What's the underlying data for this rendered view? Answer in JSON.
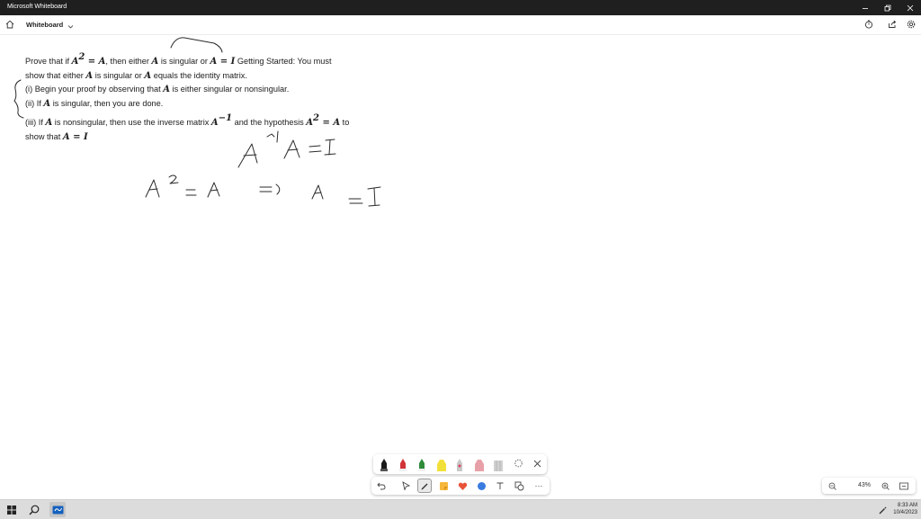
{
  "window": {
    "title": "Microsoft Whiteboard",
    "controls": [
      "minimize-icon",
      "restore-icon",
      "close-icon"
    ]
  },
  "header": {
    "board_name": "Whiteboard",
    "icons": [
      "home-icon",
      "chevron-down-icon",
      "timer-icon",
      "share-icon",
      "settings-icon"
    ]
  },
  "problem": {
    "line1": {
      "a": "Prove that if ",
      "b": ", then either ",
      "c": " is singular or ",
      "d": " Getting Started: You must"
    },
    "line2": {
      "a": "show that either ",
      "b": " is singular or ",
      "c": " equals the identity matrix."
    },
    "line3": {
      "a": "(i) Begin your proof by observing that ",
      "b": " is either singular or nonsingular."
    },
    "line4": {
      "a": "(ii) If ",
      "b": " is singular, then you are done."
    },
    "line5": {
      "a": "(iii) If ",
      "b": " is nonsingular, then use the inverse matrix ",
      "c": " and the hypothesis ",
      "d": " to"
    },
    "line6": {
      "a": "show that "
    },
    "math": {
      "A": "A",
      "two": "2",
      "eqA": " = A",
      "eqI": " = I",
      "AeqI": "A = I",
      "minus1": "−1"
    }
  },
  "handwriting": {
    "line1": "A⁻¹ A = I",
    "line2": "A² = A  ⇒  A = I"
  },
  "pen_tray": {
    "pens": [
      {
        "name": "black-pen",
        "color": "#1a1a1a"
      },
      {
        "name": "red-pen",
        "color": "#d13438"
      },
      {
        "name": "green-pen",
        "color": "#2e8b3a"
      },
      {
        "name": "yellow-highlighter",
        "color": "#f2e03a"
      },
      {
        "name": "gray-pen",
        "color": "#b8b8b8"
      },
      {
        "name": "pink-pen",
        "color": "#e8a0a8"
      },
      {
        "name": "eraser",
        "color": "#d0d0d0"
      }
    ],
    "icons": [
      "lasso-icon",
      "close-icon"
    ]
  },
  "toolbar": {
    "icons": [
      "undo-icon",
      "select-icon",
      "pen-icon",
      "sticky-note-icon",
      "reaction-icon",
      "shapes-icon",
      "text-icon",
      "insert-icon",
      "more-icon"
    ],
    "more": "···"
  },
  "zoom": {
    "value": "43%"
  },
  "taskbar": {
    "time": "8:33 AM",
    "date": "10/4/2023"
  }
}
